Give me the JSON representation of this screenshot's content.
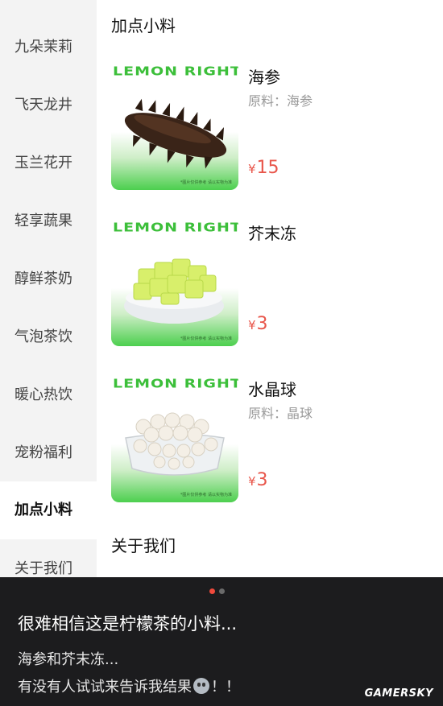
{
  "sidebar": {
    "items": [
      {
        "label": "九朵茉莉"
      },
      {
        "label": "飞天龙井"
      },
      {
        "label": "玉兰花开"
      },
      {
        "label": "轻享蔬果"
      },
      {
        "label": "醇鲜茶奶"
      },
      {
        "label": "气泡茶饮"
      },
      {
        "label": "暖心热饮"
      },
      {
        "label": "宠粉福利"
      },
      {
        "label": "加点小料"
      },
      {
        "label": "关于我们"
      }
    ],
    "active_index": 8
  },
  "main": {
    "section_title": "加点小料",
    "products": [
      {
        "brand": "LEMON RIGHT",
        "name": "海参",
        "material": "原料：海参",
        "currency": "¥",
        "price": "15",
        "image": "sea-cucumber",
        "fineprint": "*图片仅供参考 请以实物为准"
      },
      {
        "brand": "LEMON RIGHT",
        "name": "芥末冻",
        "material": "",
        "currency": "¥",
        "price": "3",
        "image": "wasabi-jelly",
        "fineprint": "*图片仅供参考 请以实物为准"
      },
      {
        "brand": "LEMON RIGHT",
        "name": "水晶球",
        "material": "原料：晶球",
        "currency": "¥",
        "price": "3",
        "image": "crystal-balls",
        "fineprint": "*图片仅供参考 请以实物为准"
      }
    ],
    "next_section_title": "关于我们"
  },
  "caption": {
    "title": "很难相信这是柠檬茶的小料...",
    "line1": "海参和芥末冻...",
    "line2": "有没有人试试来告诉我结果",
    "line2_suffix": "！！",
    "emoji": "grimace-emoji",
    "pager_total": 2,
    "pager_active": 0,
    "watermark": "GAMERSKY"
  },
  "colors": {
    "price": "#e8554a",
    "brand_green": "#3cbf3a",
    "sidebar_bg": "#f3f3f3",
    "caption_bg": "#1c1c1e",
    "pager_active": "#f04a3c"
  }
}
